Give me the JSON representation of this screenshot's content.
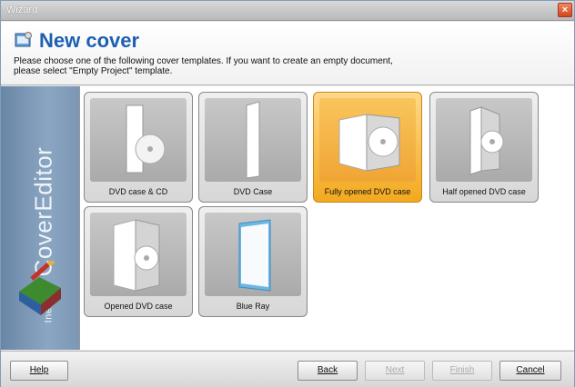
{
  "window": {
    "title": "Wizard"
  },
  "header": {
    "title": "New cover",
    "description": "Please choose one of the following cover templates. If you want to create an empty document,\nplease select \"Empty Project\" template."
  },
  "sidebar": {
    "brand_small": "Ineosoft",
    "brand": "CoverEditor"
  },
  "templates": [
    {
      "label": "DVD case & CD",
      "selected": false
    },
    {
      "label": "DVD Case",
      "selected": false
    },
    {
      "label": "Fully opened DVD case",
      "selected": true
    },
    {
      "label": "Half opened DVD case",
      "selected": false
    },
    {
      "label": "Opened DVD case",
      "selected": false
    },
    {
      "label": "Blue Ray",
      "selected": false
    }
  ],
  "footer": {
    "help": "Help",
    "back": "Back",
    "next": "Next",
    "finish": "Finish",
    "cancel": "Cancel"
  },
  "colors": {
    "title": "#1d5fb2",
    "selected": "#f3a91f",
    "sidebar": "#7b97b4"
  }
}
